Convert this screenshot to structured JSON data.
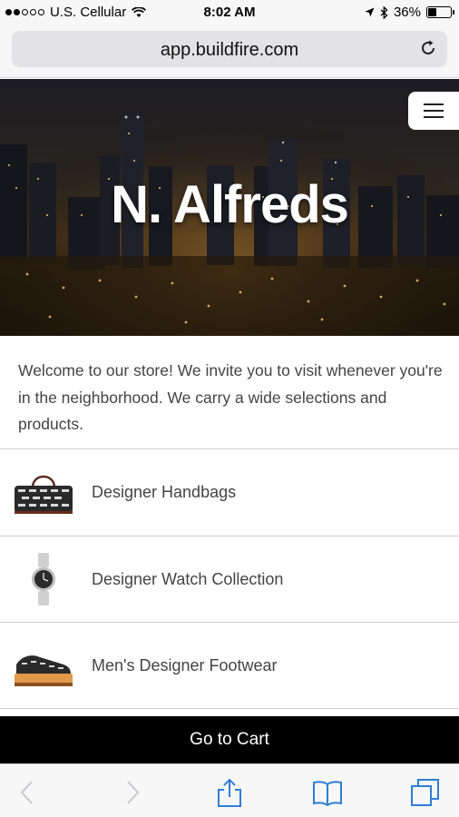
{
  "status_bar": {
    "carrier": "U.S. Cellular",
    "time": "8:02 AM",
    "battery": "36%",
    "battery_level": 0.36
  },
  "browser": {
    "url": "app.buildfire.com"
  },
  "hero": {
    "title": "N. Alfreds"
  },
  "intro": {
    "text": "Welcome to our store! We invite you to visit whenever you're in the neighborhood. We carry a wide selections and products."
  },
  "items": [
    {
      "label": "Designer Handbags",
      "icon": "handbag-icon"
    },
    {
      "label": "Designer Watch Collection",
      "icon": "watch-icon"
    },
    {
      "label": "Men's Designer Footwear",
      "icon": "shoe-icon"
    }
  ],
  "cart": {
    "label": "Go to Cart"
  },
  "colors": {
    "cart_bar": "#000000",
    "toolbar_icon": "#2f7dd6"
  }
}
